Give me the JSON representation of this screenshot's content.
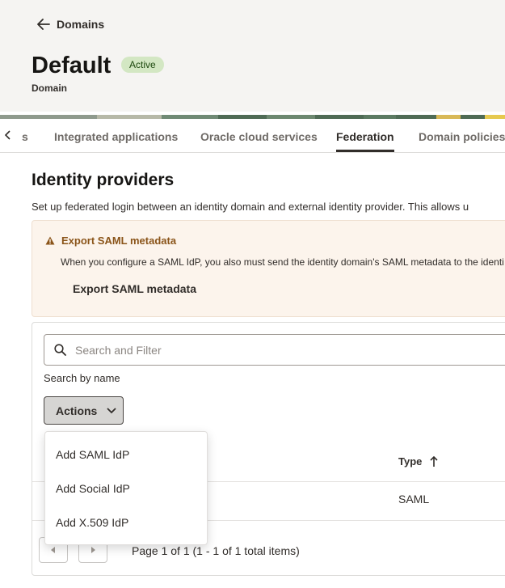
{
  "header": {
    "back_label": "Domains",
    "title": "Default",
    "status": "Active",
    "subtitle": "Domain"
  },
  "tabs": [
    {
      "label": "s"
    },
    {
      "label": "Integrated applications"
    },
    {
      "label": "Oracle cloud services"
    },
    {
      "label": "Federation",
      "active": true
    },
    {
      "label": "Domain policies"
    }
  ],
  "section": {
    "title": "Identity providers",
    "description": "Set up federated login between an identity domain and external identity provider. This allows u"
  },
  "warning": {
    "title": "Export SAML metadata",
    "text": "When you configure a SAML IdP, you also must send the identity domain's SAML metadata to the identi",
    "button": "Export SAML metadata"
  },
  "search": {
    "placeholder": "Search and Filter",
    "helper": "Search by name"
  },
  "actions": {
    "label": "Actions",
    "menu": [
      "Add SAML IdP",
      "Add Social IdP",
      "Add X.509 IdP"
    ]
  },
  "table": {
    "columns": [
      "Type"
    ],
    "rows": [
      {
        "type": "SAML"
      }
    ]
  },
  "pagination": {
    "info": "Page 1 of 1 (1 - 1 of 1 total items)"
  },
  "colors": {
    "badge_bg": "#d3e7c3",
    "warning_accent": "#8a5419",
    "warning_bg": "#fcf4ec"
  }
}
